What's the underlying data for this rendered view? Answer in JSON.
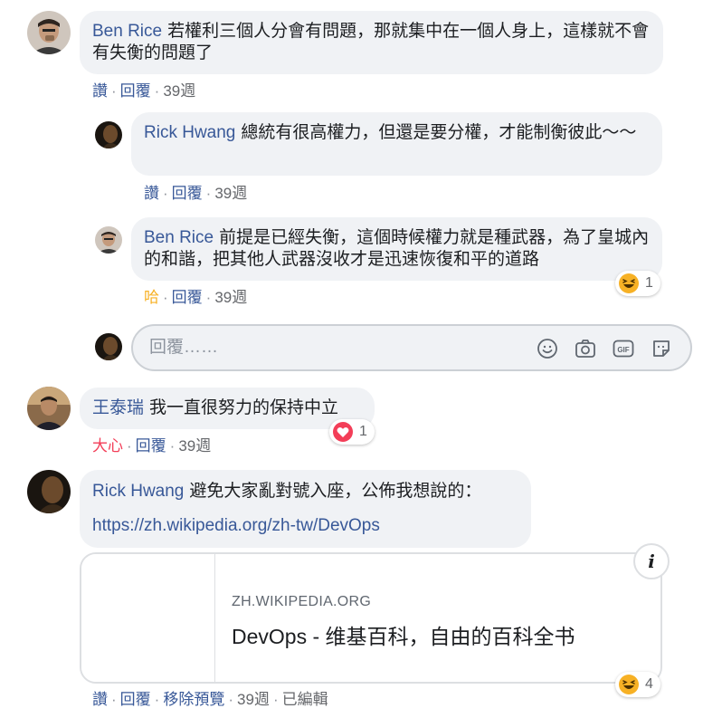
{
  "comments": [
    {
      "author": "Ben Rice",
      "text": "若權利三個人分會有問題，那就集中在一個人身上，這樣就不會有失衡的問題了",
      "actions": {
        "like": "讚",
        "reply": "回覆",
        "time": "39週"
      }
    },
    {
      "author": "Rick Hwang",
      "text": "總統有很高權力，但還是要分權，才能制衡彼此～～",
      "actions": {
        "like": "讚",
        "reply": "回覆",
        "time": "39週"
      }
    },
    {
      "author": "Ben Rice",
      "text": "前提是已經失衡，這個時候權力就是種武器，為了皇城內的和諧，把其他人武器沒收才是迅速恢復和平的道路",
      "actions": {
        "like": "哈",
        "reply": "回覆",
        "time": "39週"
      },
      "reaction": {
        "icon": "haha-emoji-icon",
        "count": "1"
      }
    },
    {
      "author": "王泰瑞",
      "text": "我一直很努力的保持中立",
      "actions": {
        "like": "大心",
        "reply": "回覆",
        "time": "39週"
      },
      "reaction": {
        "icon": "love-heart-icon",
        "count": "1"
      }
    },
    {
      "author": "Rick Hwang",
      "text": "避免大家亂對號入座，公佈我想說的：",
      "link": "https://zh.wikipedia.org/zh-tw/DevOps",
      "preview": {
        "domain": "ZH.WIKIPEDIA.ORG",
        "title": "DevOps - 维基百科，自由的百科全书",
        "info": "i"
      },
      "actions": {
        "like": "讚",
        "reply": "回覆",
        "remove_preview": "移除預覽",
        "time": "39週",
        "edited": "已編輯"
      },
      "reaction": {
        "icon": "haha-emoji-icon",
        "count": "4"
      }
    }
  ],
  "reply_box": {
    "placeholder": "回覆……",
    "icons": [
      "emoji-icon",
      "camera-icon",
      "gif-icon",
      "sticker-icon"
    ]
  },
  "colors": {
    "name": "#385898",
    "bubble": "#f0f2f5",
    "haha": "#f7b125",
    "love": "#f33e58"
  }
}
